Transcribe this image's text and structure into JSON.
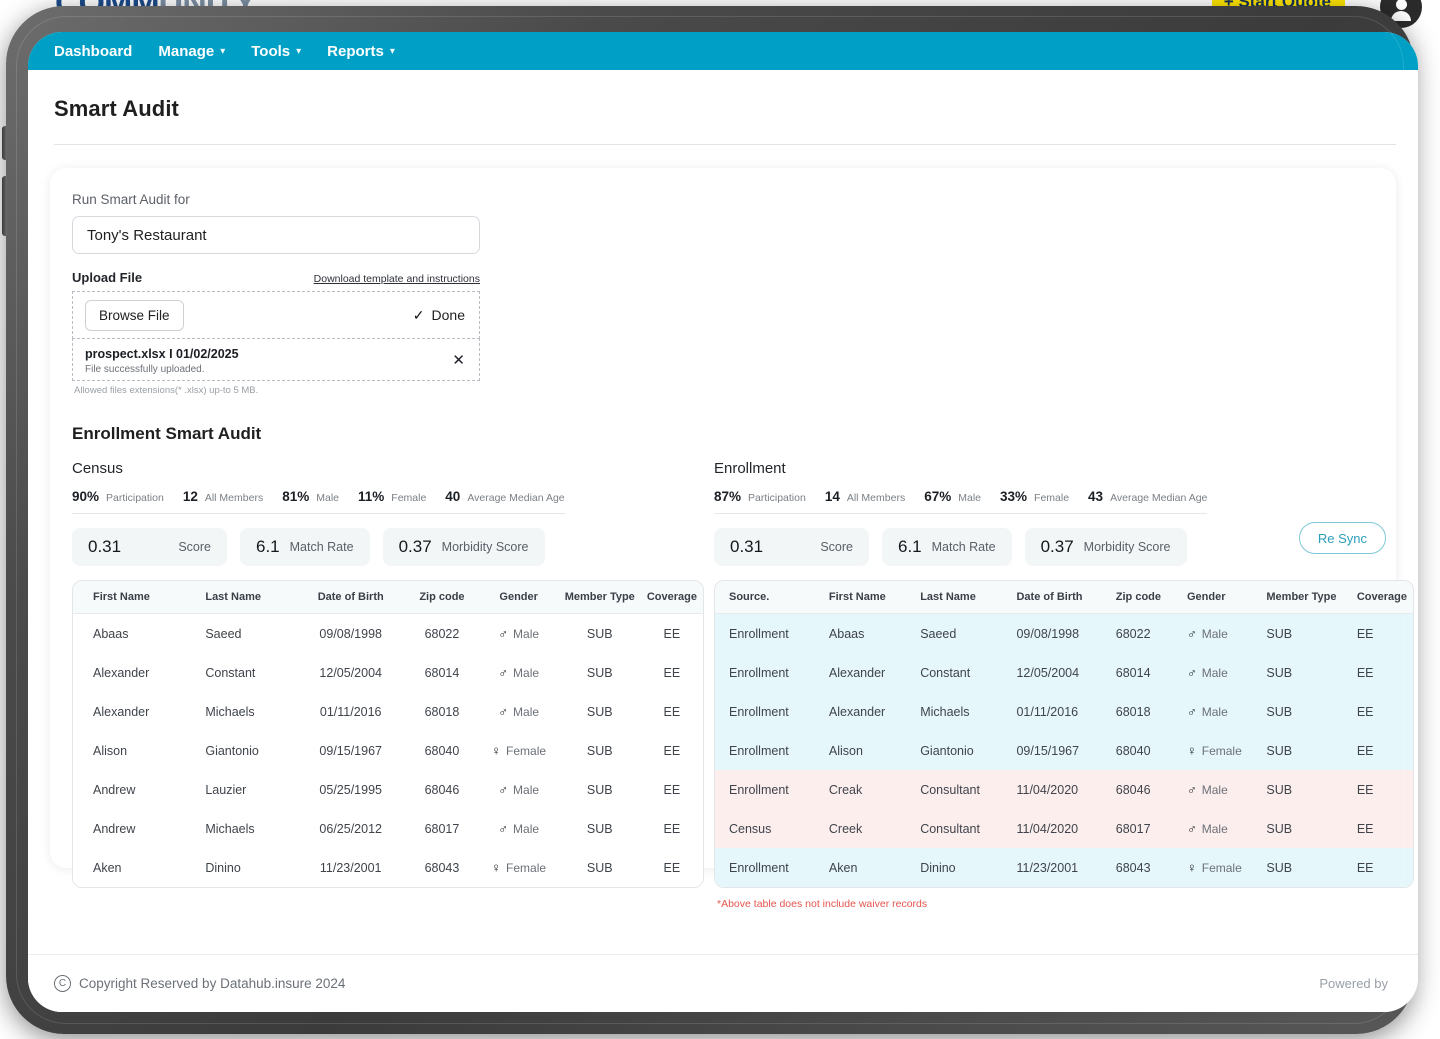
{
  "background": {
    "logo_main": "COMM",
    "logo_rest": "UNITY",
    "quote_button": "+ Start Quote"
  },
  "nav": {
    "items": [
      {
        "label": "Dashboard",
        "has_caret": false
      },
      {
        "label": "Manage",
        "has_caret": true
      },
      {
        "label": "Tools",
        "has_caret": true
      },
      {
        "label": "Reports",
        "has_caret": true
      }
    ],
    "caret": "▾",
    "accent": "#00a0c6"
  },
  "page": {
    "title": "Smart Audit"
  },
  "upload": {
    "run_for_label": "Run Smart Audit for",
    "org_value": "Tony's Restaurant",
    "upload_file_label": "Upload File",
    "download_link": "Download template and instructions",
    "browse_label": "Browse File",
    "done_label": "Done",
    "check_icon": "✓",
    "file_name": "prospect.xlsx I 01/02/2025",
    "file_status": "File successfully uploaded.",
    "remove_icon": "✕",
    "allowed_note": "Allowed files extensions(* .xlsx) up-to 5 MB."
  },
  "audit": {
    "section_title": "Enrollment Smart Audit",
    "resync_button": "Re Sync",
    "waiver_note": "*Above table does not include waiver records",
    "census": {
      "heading": "Census",
      "stats": [
        {
          "value": "90%",
          "label": "Participation"
        },
        {
          "value": "12",
          "label": "All Members"
        },
        {
          "value": "81%",
          "label": "Male"
        },
        {
          "value": "11%",
          "label": "Female"
        },
        {
          "value": "40",
          "label": "Average Median Age"
        }
      ],
      "scores": [
        {
          "value": "0.31",
          "caption": "Score"
        },
        {
          "value": "6.1",
          "caption": "Match Rate"
        },
        {
          "value": "0.37",
          "caption": "Morbidity Score"
        }
      ],
      "columns": [
        "First Name",
        "Last Name",
        "Date of Birth",
        "Zip code",
        "Gender",
        "Member Type",
        "Coverage"
      ],
      "rows": [
        {
          "first_name": "Abaas",
          "last_name": "Saeed",
          "dob": "09/08/1998",
          "zip": "68022",
          "gender": "Male",
          "gender_symbol": "♂",
          "member_type": "SUB",
          "coverage": "EE"
        },
        {
          "first_name": "Alexander",
          "last_name": "Constant",
          "dob": "12/05/2004",
          "zip": "68014",
          "gender": "Male",
          "gender_symbol": "♂",
          "member_type": "SUB",
          "coverage": "EE"
        },
        {
          "first_name": "Alexander",
          "last_name": "Michaels",
          "dob": "01/11/2016",
          "zip": "68018",
          "gender": "Male",
          "gender_symbol": "♂",
          "member_type": "SUB",
          "coverage": "EE"
        },
        {
          "first_name": "Alison",
          "last_name": "Giantonio",
          "dob": "09/15/1967",
          "zip": "68040",
          "gender": "Female",
          "gender_symbol": "♀",
          "member_type": "SUB",
          "coverage": "EE"
        },
        {
          "first_name": "Andrew",
          "last_name": "Lauzier",
          "dob": "05/25/1995",
          "zip": "68046",
          "gender": "Male",
          "gender_symbol": "♂",
          "member_type": "SUB",
          "coverage": "EE"
        },
        {
          "first_name": "Andrew",
          "last_name": "Michaels",
          "dob": "06/25/2012",
          "zip": "68017",
          "gender": "Male",
          "gender_symbol": "♂",
          "member_type": "SUB",
          "coverage": "EE"
        },
        {
          "first_name": "Aken",
          "last_name": "Dinino",
          "dob": "11/23/2001",
          "zip": "68043",
          "gender": "Female",
          "gender_symbol": "♀",
          "member_type": "SUB",
          "coverage": "EE"
        }
      ]
    },
    "enrollment": {
      "heading": "Enrollment",
      "stats": [
        {
          "value": "87%",
          "label": "Participation"
        },
        {
          "value": "14",
          "label": "All Members"
        },
        {
          "value": "67%",
          "label": "Male"
        },
        {
          "value": "33%",
          "label": "Female"
        },
        {
          "value": "43",
          "label": "Average Median Age"
        }
      ],
      "scores": [
        {
          "value": "0.31",
          "caption": "Score"
        },
        {
          "value": "6.1",
          "caption": "Match Rate"
        },
        {
          "value": "0.37",
          "caption": "Morbidity Score"
        }
      ],
      "columns": [
        "Source.",
        "First Name",
        "Last Name",
        "Date of Birth",
        "Zip code",
        "Gender",
        "Member Type",
        "Coverage"
      ],
      "rows": [
        {
          "source": "Enrollment",
          "first_name": "Abaas",
          "last_name": "Saeed",
          "dob": "09/08/1998",
          "zip": "68022",
          "gender": "Male",
          "gender_symbol": "♂",
          "member_type": "SUB",
          "coverage": "EE",
          "state": "match"
        },
        {
          "source": "Enrollment",
          "first_name": "Alexander",
          "last_name": "Constant",
          "dob": "12/05/2004",
          "zip": "68014",
          "gender": "Male",
          "gender_symbol": "♂",
          "member_type": "SUB",
          "coverage": "EE",
          "state": "match"
        },
        {
          "source": "Enrollment",
          "first_name": "Alexander",
          "last_name": "Michaels",
          "dob": "01/11/2016",
          "zip": "68018",
          "gender": "Male",
          "gender_symbol": "♂",
          "member_type": "SUB",
          "coverage": "EE",
          "state": "match"
        },
        {
          "source": "Enrollment",
          "first_name": "Alison",
          "last_name": "Giantonio",
          "dob": "09/15/1967",
          "zip": "68040",
          "gender": "Female",
          "gender_symbol": "♀",
          "member_type": "SUB",
          "coverage": "EE",
          "state": "match"
        },
        {
          "source": "Enrollment",
          "first_name": "Creak",
          "last_name": "Consultant",
          "dob": "11/04/2020",
          "zip": "68046",
          "gender": "Male",
          "gender_symbol": "♂",
          "member_type": "SUB",
          "coverage": "EE",
          "state": "mismatch"
        },
        {
          "source": "Census",
          "first_name": "Creek",
          "last_name": "Consultant",
          "dob": "11/04/2020",
          "zip": "68017",
          "gender": "Male",
          "gender_symbol": "♂",
          "member_type": "SUB",
          "coverage": "EE",
          "state": "mismatch"
        },
        {
          "source": "Enrollment",
          "first_name": "Aken",
          "last_name": "Dinino",
          "dob": "11/23/2001",
          "zip": "68043",
          "gender": "Female",
          "gender_symbol": "♀",
          "member_type": "SUB",
          "coverage": "EE",
          "state": "match"
        }
      ],
      "row_colors": {
        "match": "#e6f7fb",
        "mismatch": "#fdeeee"
      }
    }
  },
  "footer": {
    "copyright": "Copyright Reserved by Datahub.insure 2024",
    "copyright_icon": "C",
    "powered": "Powered by"
  }
}
